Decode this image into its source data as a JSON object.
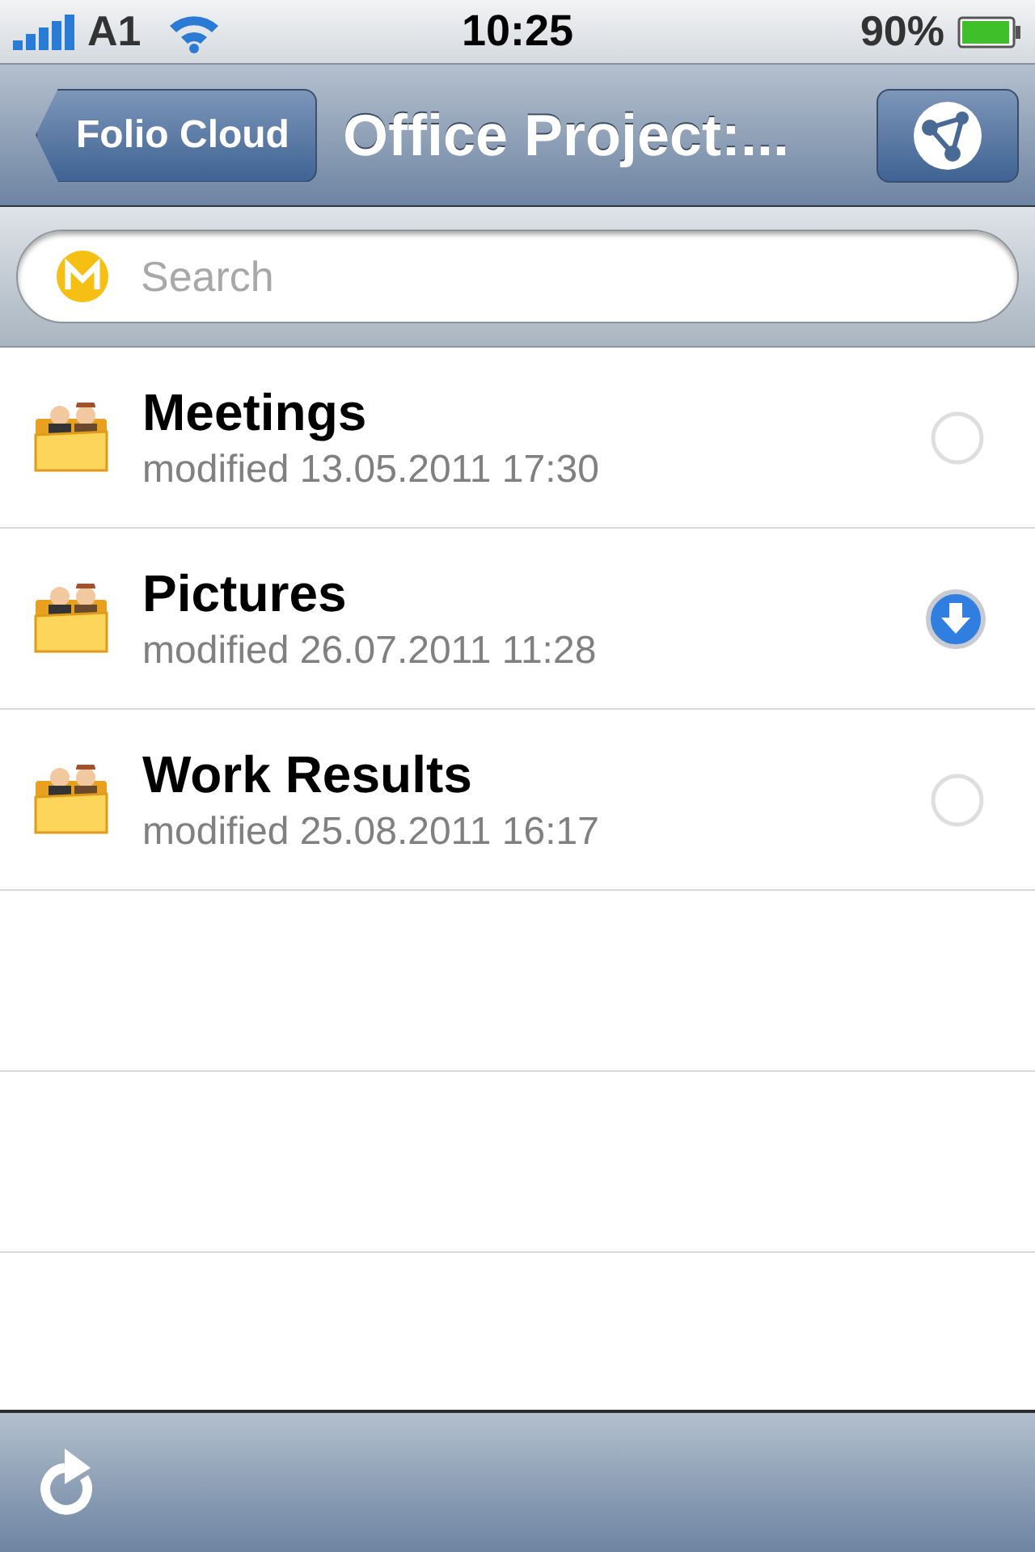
{
  "status_bar": {
    "carrier": "A1",
    "time": "10:25",
    "battery": "90%"
  },
  "nav_bar": {
    "back": "Folio Cloud",
    "title": "Office Project:..."
  },
  "search": {
    "placeholder": "Search"
  },
  "folders": [
    {
      "name": "Meetings",
      "modified": "modified 13.05.2011 17:30",
      "download": false
    },
    {
      "name": "Pictures",
      "modified": "modified 26.07.2011 11:28",
      "download": true
    },
    {
      "name": "Work Results",
      "modified": "modified 25.08.2011 16:17",
      "download": false
    }
  ]
}
